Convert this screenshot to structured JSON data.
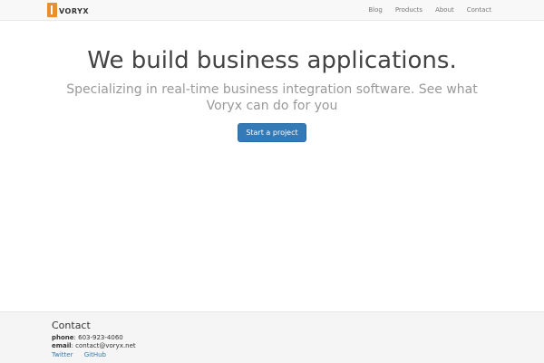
{
  "navbar": {
    "brand_name": "VORYX",
    "links": [
      "Blog",
      "Products",
      "About",
      "Contact"
    ]
  },
  "hero": {
    "title": "We build business applications.",
    "subtitle": "Specializing in real-time business integration software. See what Voryx can do for you",
    "cta_label": "Start a project"
  },
  "footer": {
    "title": "Contact",
    "phone_label": "phone",
    "phone_value": "603-923-4060",
    "email_label": "email",
    "email_value": "contact@voryx.net",
    "links": [
      "Twitter",
      "GitHub"
    ]
  },
  "colors": {
    "accent": "#337ab7",
    "brand": "#e8912c",
    "navbar_bg": "#f8f8f8",
    "footer_bg": "#f5f5f5"
  }
}
